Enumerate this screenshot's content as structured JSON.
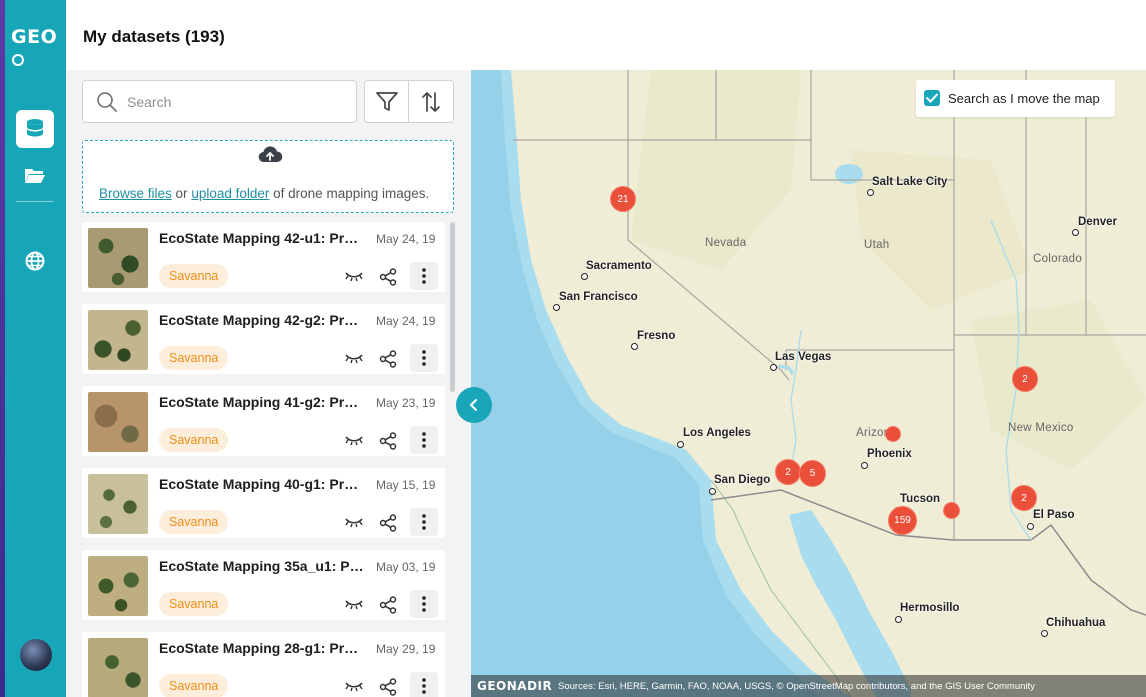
{
  "app": {
    "logo_text": "GEO"
  },
  "rail": {
    "items": [
      {
        "icon": "database-icon",
        "active": true
      },
      {
        "icon": "folder-icon",
        "active": false
      },
      {
        "icon": "globe-icon",
        "active": false
      }
    ]
  },
  "header": {
    "title": "My datasets (193)"
  },
  "search": {
    "placeholder": "Search",
    "value": ""
  },
  "toolbar": {
    "filter_icon": "filter-icon",
    "sort_icon": "sort-icon"
  },
  "upload": {
    "browse_label": "Browse files",
    "or_text": "or",
    "folder_label": "upload folder",
    "suffix": "of drone mapping images."
  },
  "datasets": [
    {
      "title": "EcoState Mapping 42-u1: Pre…",
      "date": "May 24, 19",
      "tag": "Savanna"
    },
    {
      "title": "EcoState Mapping 42-g2: Pre…",
      "date": "May 24, 19",
      "tag": "Savanna"
    },
    {
      "title": "EcoState Mapping 41-g2: Pre…",
      "date": "May 23, 19",
      "tag": "Savanna"
    },
    {
      "title": "EcoState Mapping 40-g1: Pre…",
      "date": "May 15, 19",
      "tag": "Savanna"
    },
    {
      "title": "EcoState Mapping 35a_u1: Pr…",
      "date": "May 03, 19",
      "tag": "Savanna"
    },
    {
      "title": "EcoState Mapping 28-g1: Pre…",
      "date": "May 29, 19",
      "tag": "Savanna"
    }
  ],
  "map": {
    "search_as_move": {
      "label": "Search as I move the map",
      "checked": true
    },
    "cities": [
      "Salt Lake City",
      "Denver",
      "Sacramento",
      "San Francisco",
      "Fresno",
      "Las Vegas",
      "Los Angeles",
      "San Diego",
      "Phoenix",
      "Tucson",
      "El Paso",
      "Hermosillo",
      "Chihuahua"
    ],
    "states": [
      "Nevada",
      "Utah",
      "Colorado",
      "Arizona",
      "New Mexico"
    ],
    "clusters": [
      "21",
      "2",
      "5",
      "159",
      "2",
      "2",
      ""
    ],
    "attribution": {
      "brand": "GEONADIR",
      "sources": "Sources: Esri, HERE, Garmin, FAO, NOAA, USGS, © OpenStreetMap contributors, and the GIS User Community"
    },
    "water_color": "#a8dcef",
    "land_color": "#f0edd6",
    "cluster_color": "#ea4f3a"
  },
  "colors": {
    "brand": "#17a5b8",
    "tag_bg": "#fdeedb",
    "tag_text": "#f08c1a"
  }
}
